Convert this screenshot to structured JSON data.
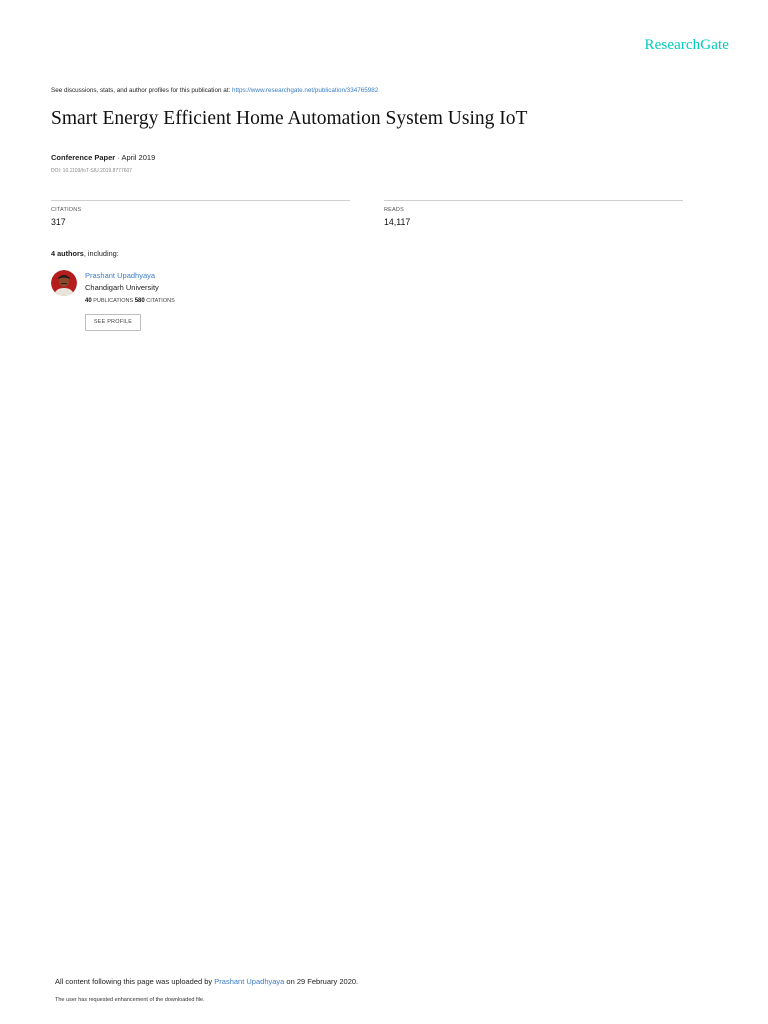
{
  "brand": {
    "logo_text": "ResearchGate",
    "accent_color": "#00ccbb",
    "link_color": "#3a7cc6"
  },
  "header": {
    "see_text": "See discussions, stats, and author profiles for this publication at: ",
    "publication_url": "https://www.researchgate.net/publication/334765982"
  },
  "paper": {
    "title": "Smart Energy Efficient Home Automation System Using IoT",
    "type": "Conference Paper",
    "date": "April 2019",
    "doi": "DOI: 10.1109/IoT-SIU.2019.8777607"
  },
  "stats": {
    "citations_label": "CITATIONS",
    "citations_value": "317",
    "reads_label": "READS",
    "reads_value": "14,117"
  },
  "authors": {
    "count_text": "4 authors",
    "including_text": ", including:",
    "list": [
      {
        "name": "Prashant Upadhyaya",
        "institution": "Chandigarh University",
        "publications_count": "40",
        "publications_label": "PUBLICATIONS",
        "citations_count": "580",
        "citations_label": "CITATIONS",
        "profile_button": "SEE PROFILE"
      }
    ]
  },
  "footer": {
    "upload_prefix": "All content following this page was uploaded by ",
    "uploader": "Prashant Upadhyaya",
    "upload_suffix": " on 29 February 2020.",
    "enhancement_note": "The user has requested enhancement of the downloaded file."
  }
}
